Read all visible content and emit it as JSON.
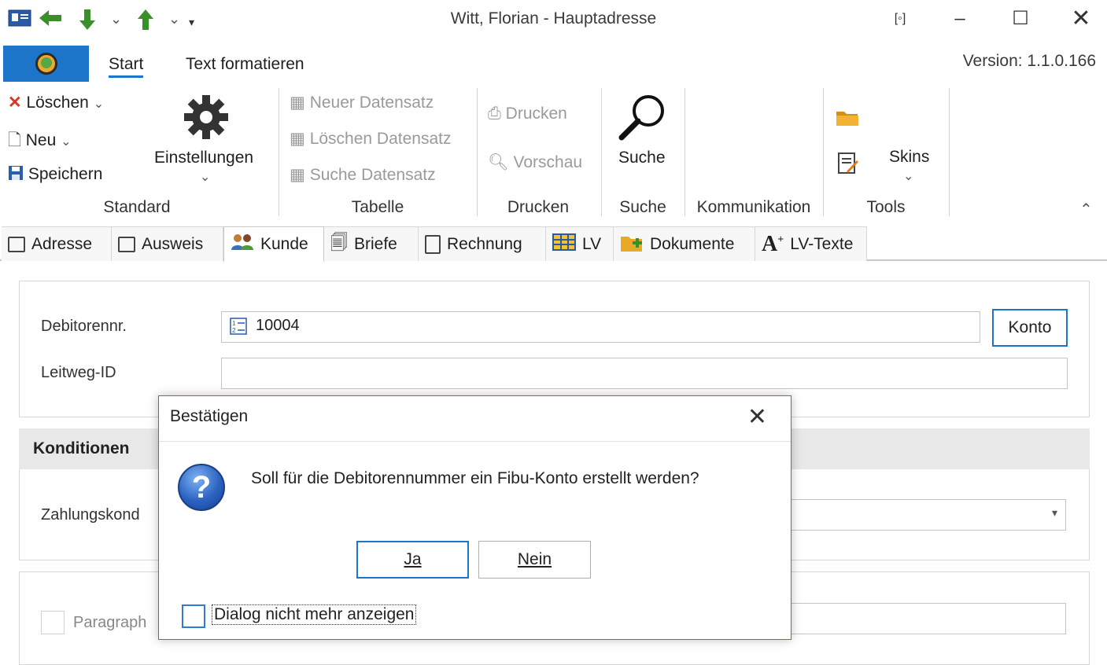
{
  "window": {
    "title": "Witt, Florian - Hauptadresse",
    "version": "Version: 1.1.0.166"
  },
  "ribbon": {
    "tabs": [
      "Start",
      "Text formatieren"
    ],
    "standard": {
      "loeschen": "Löschen",
      "neu": "Neu",
      "speichern": "Speichern",
      "einstellungen": "Einstellungen",
      "group": "Standard"
    },
    "tabelle": {
      "neuer": "Neuer Datensatz",
      "loeschen": "Löschen Datensatz",
      "suche": "Suche Datensatz",
      "group": "Tabelle"
    },
    "drucken": {
      "drucken": "Drucken",
      "vorschau": "Vorschau",
      "group": "Drucken"
    },
    "suche": {
      "suche": "Suche",
      "group": "Suche"
    },
    "kommunikation": {
      "group": "Kommunikation"
    },
    "tools": {
      "skins": "Skins",
      "group": "Tools"
    }
  },
  "doc_tabs": [
    "Adresse",
    "Ausweis",
    "Kunde",
    "Briefe",
    "Rechnung",
    "LV",
    "Dokumente",
    "LV-Texte"
  ],
  "form": {
    "debitorennr_label": "Debitorennr.",
    "debitorennr_value": "10004",
    "konto_button": "Konto",
    "leitweg_label": "Leitweg-ID",
    "konditionen": "Konditionen",
    "zahlungskond_label": "Zahlungskond",
    "paragraph_label": "Paragraph"
  },
  "dialog": {
    "title": "Bestätigen",
    "message": "Soll für die Debitorennummer ein Fibu-Konto erstellt werden?",
    "yes": "Ja",
    "no": "Nein",
    "checkbox": "Dialog nicht mehr anzeigen"
  }
}
